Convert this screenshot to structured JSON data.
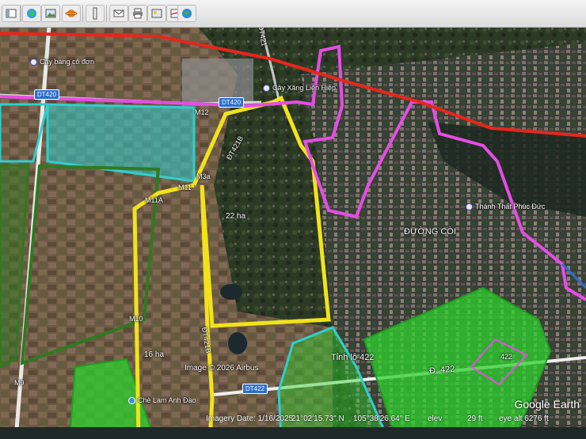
{
  "toolbar": {
    "buttons": [
      {
        "name": "sidebar-toggle-icon"
      },
      {
        "name": "placemark-icon"
      },
      {
        "name": "image-overlay-icon"
      },
      {
        "name": "planet-icon"
      },
      {
        "name": "ruler-icon"
      },
      {
        "name": "email-icon"
      },
      {
        "name": "print-icon"
      },
      {
        "name": "save-image-icon"
      },
      {
        "name": "maps-icon"
      }
    ]
  },
  "map": {
    "roads": {
      "dt420_left": "DT420",
      "dt420_right": "DT420",
      "dt422": "DT422",
      "dt421_top": "DT421",
      "dt421b": "ĐT421B",
      "dt421b_low": "ĐT421B"
    },
    "markers": {
      "m12": "M12",
      "m11a": "M11A",
      "m11": "M11",
      "m3a": "M3a",
      "m10": "M10",
      "m9": "M9"
    },
    "areas": {
      "area_22": "22 ha",
      "area_16": "16 ha"
    },
    "places": {
      "cay_bang": "Cây bàng cô đơn",
      "cay_xang": "Cây Xăng Liên Hiệp",
      "thanh_that": "Thánh Thất Phúc Đức",
      "duong_coi": "ĐƯỜNG CÒI",
      "tinh_lo": "Tỉnh lộ 422",
      "d422": "Đ. 422",
      "label_422": "422",
      "chua": "Chè Lam Anh Đào"
    },
    "colors": {
      "boundary_red": "#e8261c",
      "boundary_magenta": "#e64de6",
      "boundary_yellow": "#f2e21a",
      "zone_cyan": "#2fcfcf",
      "zone_green": "#2ed12e",
      "zone_darkgreen": "#2f7a1f"
    }
  },
  "overlay": {
    "copyright": "Image © 2026 Airbus",
    "brand": "Google Earth"
  },
  "status": {
    "imagery_date": "Imagery Date: 1/16/2025",
    "lat": "21°02'15.73\" N",
    "lon": "105°38'26.64\" E",
    "elev_label": "elev",
    "elev_value": "29 ft",
    "eye_alt": "eye alt 6276 ft"
  }
}
